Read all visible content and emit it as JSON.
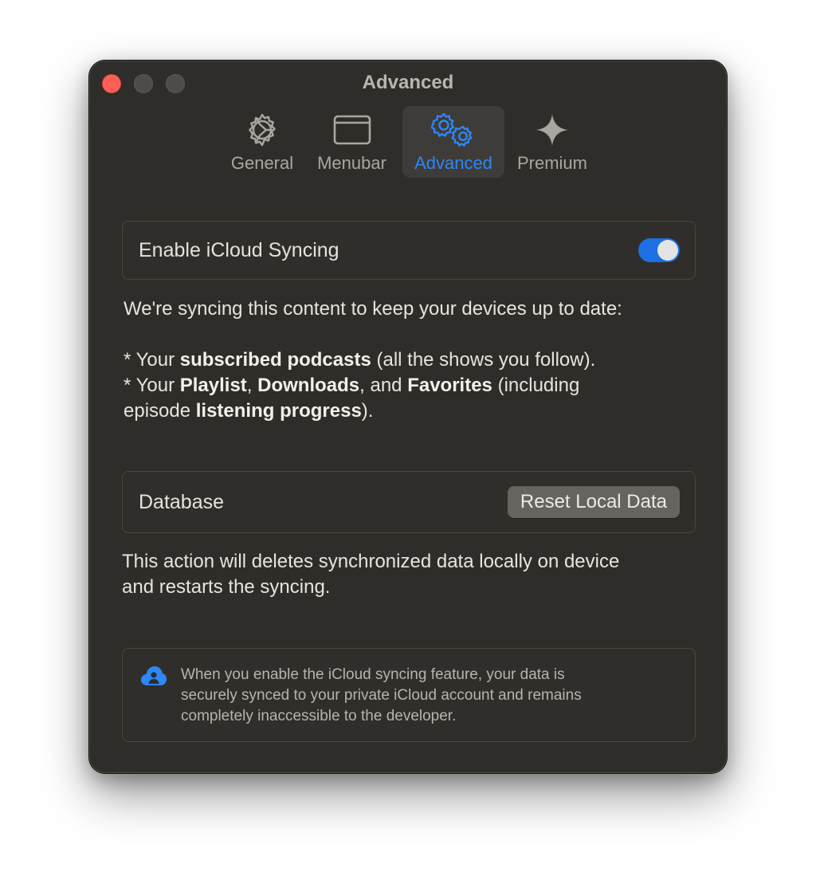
{
  "window": {
    "title": "Advanced"
  },
  "tabs": [
    {
      "label": "General",
      "icon": "gear-icon",
      "selected": false
    },
    {
      "label": "Menubar",
      "icon": "window-icon",
      "selected": false
    },
    {
      "label": "Advanced",
      "icon": "gears-icon",
      "selected": true
    },
    {
      "label": "Premium",
      "icon": "sparkle-icon",
      "selected": false
    }
  ],
  "sync": {
    "label": "Enable iCloud Syncing",
    "enabled": true,
    "intro": "We're syncing this content to keep your devices up to date:",
    "line1": {
      "prefix": "* Your ",
      "bold1": "subscribed podcasts",
      "suffix": " (all the shows you follow)."
    },
    "line2": {
      "prefix": "* Your ",
      "bold1": "Playlist",
      "sep1": ", ",
      "bold2": "Downloads",
      "sep2": ", and ",
      "bold3": "Favorites",
      "suffix": " (including"
    },
    "line3": {
      "prefix": "episode ",
      "bold1": "listening progress",
      "suffix": ")."
    }
  },
  "database": {
    "label": "Database",
    "button_label": "Reset Local Data",
    "desc_line1": "This action will deletes synchronized data locally on device",
    "desc_line2": "and restarts the syncing."
  },
  "notice": {
    "icon": "icloud-person-icon",
    "line1": "When you enable the iCloud syncing feature, your data is",
    "line2": "securely synced to your private iCloud account and remains",
    "line3": "completely inaccessible to the developer."
  },
  "colors": {
    "accent": "#2f86f6",
    "toggle_on": "#1d6fe4",
    "close_button": "#ff5f57",
    "window_background": "#2e2d29"
  }
}
